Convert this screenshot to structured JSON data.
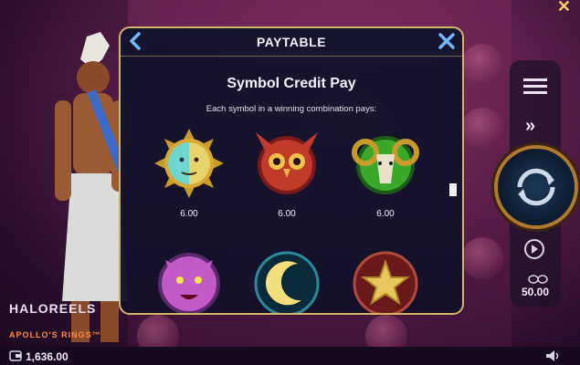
{
  "game": {
    "logo_main": "HALOREELS",
    "logo_sub": "APOLLO'S RINGS™"
  },
  "paytable": {
    "title": "PAYTABLE",
    "section_title": "Symbol Credit Pay",
    "description": "Each symbol in a winning combination pays:",
    "symbols": [
      {
        "name": "sun-moon",
        "pay": "6.00"
      },
      {
        "name": "owl",
        "pay": "6.00"
      },
      {
        "name": "ram",
        "pay": "6.00"
      },
      {
        "name": "panther",
        "pay": ""
      },
      {
        "name": "crescent-moon",
        "pay": ""
      },
      {
        "name": "star",
        "pay": ""
      }
    ]
  },
  "status": {
    "balance": "1,636.00",
    "bet": "50.00"
  },
  "colors": {
    "accent_gold": "#d7b36a",
    "modal_bg": "#141430",
    "icon_blue": "#6fb8ff"
  }
}
